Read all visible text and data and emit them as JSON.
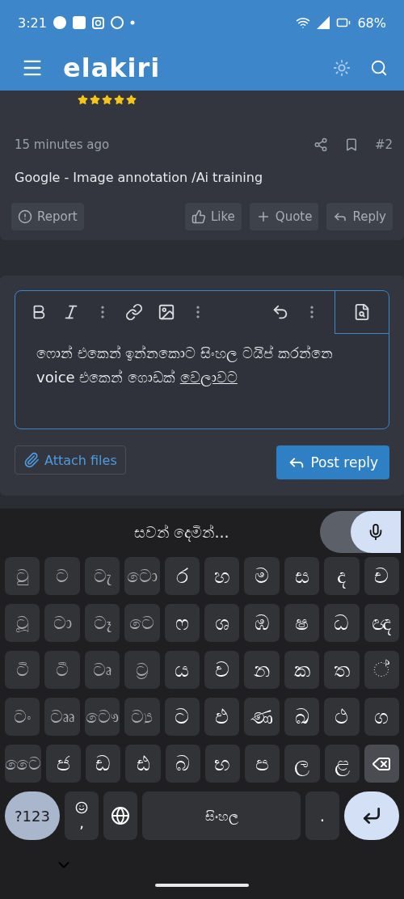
{
  "status_bar": {
    "time": "3:21",
    "battery": "68%"
  },
  "header": {
    "logo": "elakiri"
  },
  "post": {
    "stars": 5,
    "time": "15 minutes ago",
    "number": "#2",
    "title": "Google - Image annotation /Ai training",
    "actions": [
      "Report",
      "Like",
      "Quote",
      "Reply"
    ]
  },
  "editor": {
    "body": "ෆොන් එකෙන් ඉන්නකොට සිංහල ටයිප් කරන්නෙ voice එකෙන් ගොඩක් ",
    "composing": "වෙලාවට",
    "attach": "Attach files",
    "submit": "Post reply"
  },
  "keyboard": {
    "suggestion": "සවන් දෙමින්...",
    "mic_on": true,
    "rows": [
      [
        {
          "label": "ටු",
          "kind": "sign"
        },
        {
          "label": "ට",
          "kind": "sign"
        },
        {
          "label": "ටැ",
          "kind": "sign"
        },
        {
          "label": "ටො",
          "kind": "sign"
        },
        {
          "label": "ර",
          "kind": "letter"
        },
        {
          "label": "හ",
          "kind": "letter"
        },
        {
          "label": "ම",
          "kind": "letter"
        },
        {
          "label": "ස",
          "kind": "letter"
        },
        {
          "label": "ද",
          "kind": "letter"
        },
        {
          "label": "ච",
          "kind": "letter"
        }
      ],
      [
        {
          "label": "ටූ",
          "kind": "sign"
        },
        {
          "label": "ටා",
          "kind": "sign"
        },
        {
          "label": "ටෑ",
          "kind": "sign"
        },
        {
          "label": "ටෙ",
          "kind": "sign"
        },
        {
          "label": "ෆ",
          "kind": "letter"
        },
        {
          "label": "ශ",
          "kind": "letter"
        },
        {
          "label": "ඹ",
          "kind": "letter"
        },
        {
          "label": "ෂ",
          "kind": "letter"
        },
        {
          "label": "ධ",
          "kind": "letter"
        },
        {
          "label": "ඥ",
          "kind": "letter"
        }
      ],
      [
        {
          "label": "ටි",
          "kind": "sign"
        },
        {
          "label": "ටී",
          "kind": "sign"
        },
        {
          "label": "ටෘ",
          "kind": "sign"
        },
        {
          "label": "ට්‍ර",
          "kind": "sign"
        },
        {
          "label": "ය",
          "kind": "letter"
        },
        {
          "label": "ව",
          "kind": "letter"
        },
        {
          "label": "න",
          "kind": "letter"
        },
        {
          "label": "ක",
          "kind": "letter"
        },
        {
          "label": "ත",
          "kind": "letter"
        },
        {
          "label": "◌්",
          "kind": "letter"
        }
      ],
      [
        {
          "label": "ටං",
          "kind": "sign"
        },
        {
          "label": "ටෲ",
          "kind": "sign"
        },
        {
          "label": "ටෞ",
          "kind": "sign"
        },
        {
          "label": "ට්‍ය",
          "kind": "sign"
        },
        {
          "label": "ට",
          "kind": "letter"
        },
        {
          "label": "ඵ",
          "kind": "letter"
        },
        {
          "label": "ණ",
          "kind": "letter"
        },
        {
          "label": "ඛ",
          "kind": "letter"
        },
        {
          "label": "ථ",
          "kind": "letter"
        },
        {
          "label": "ග",
          "kind": "letter"
        }
      ],
      [
        {
          "label": "ටෛ",
          "kind": "sign"
        },
        {
          "label": "ජ",
          "kind": "letter"
        },
        {
          "label": "ඩ",
          "kind": "letter"
        },
        {
          "label": "ඪ",
          "kind": "letter"
        },
        {
          "label": "බ",
          "kind": "letter"
        },
        {
          "label": "භ",
          "kind": "letter"
        },
        {
          "label": "ප",
          "kind": "letter"
        },
        {
          "label": "ල",
          "kind": "letter"
        },
        {
          "label": "ළ",
          "kind": "letter"
        },
        {
          "kind": "backspace"
        }
      ]
    ],
    "bottom": [
      {
        "kind": "symbols",
        "label": "?123"
      },
      {
        "kind": "comma",
        "label": ","
      },
      {
        "kind": "globe"
      },
      {
        "kind": "space",
        "label": "සිංහල"
      },
      {
        "kind": "period",
        "label": "."
      },
      {
        "kind": "enter"
      }
    ]
  }
}
